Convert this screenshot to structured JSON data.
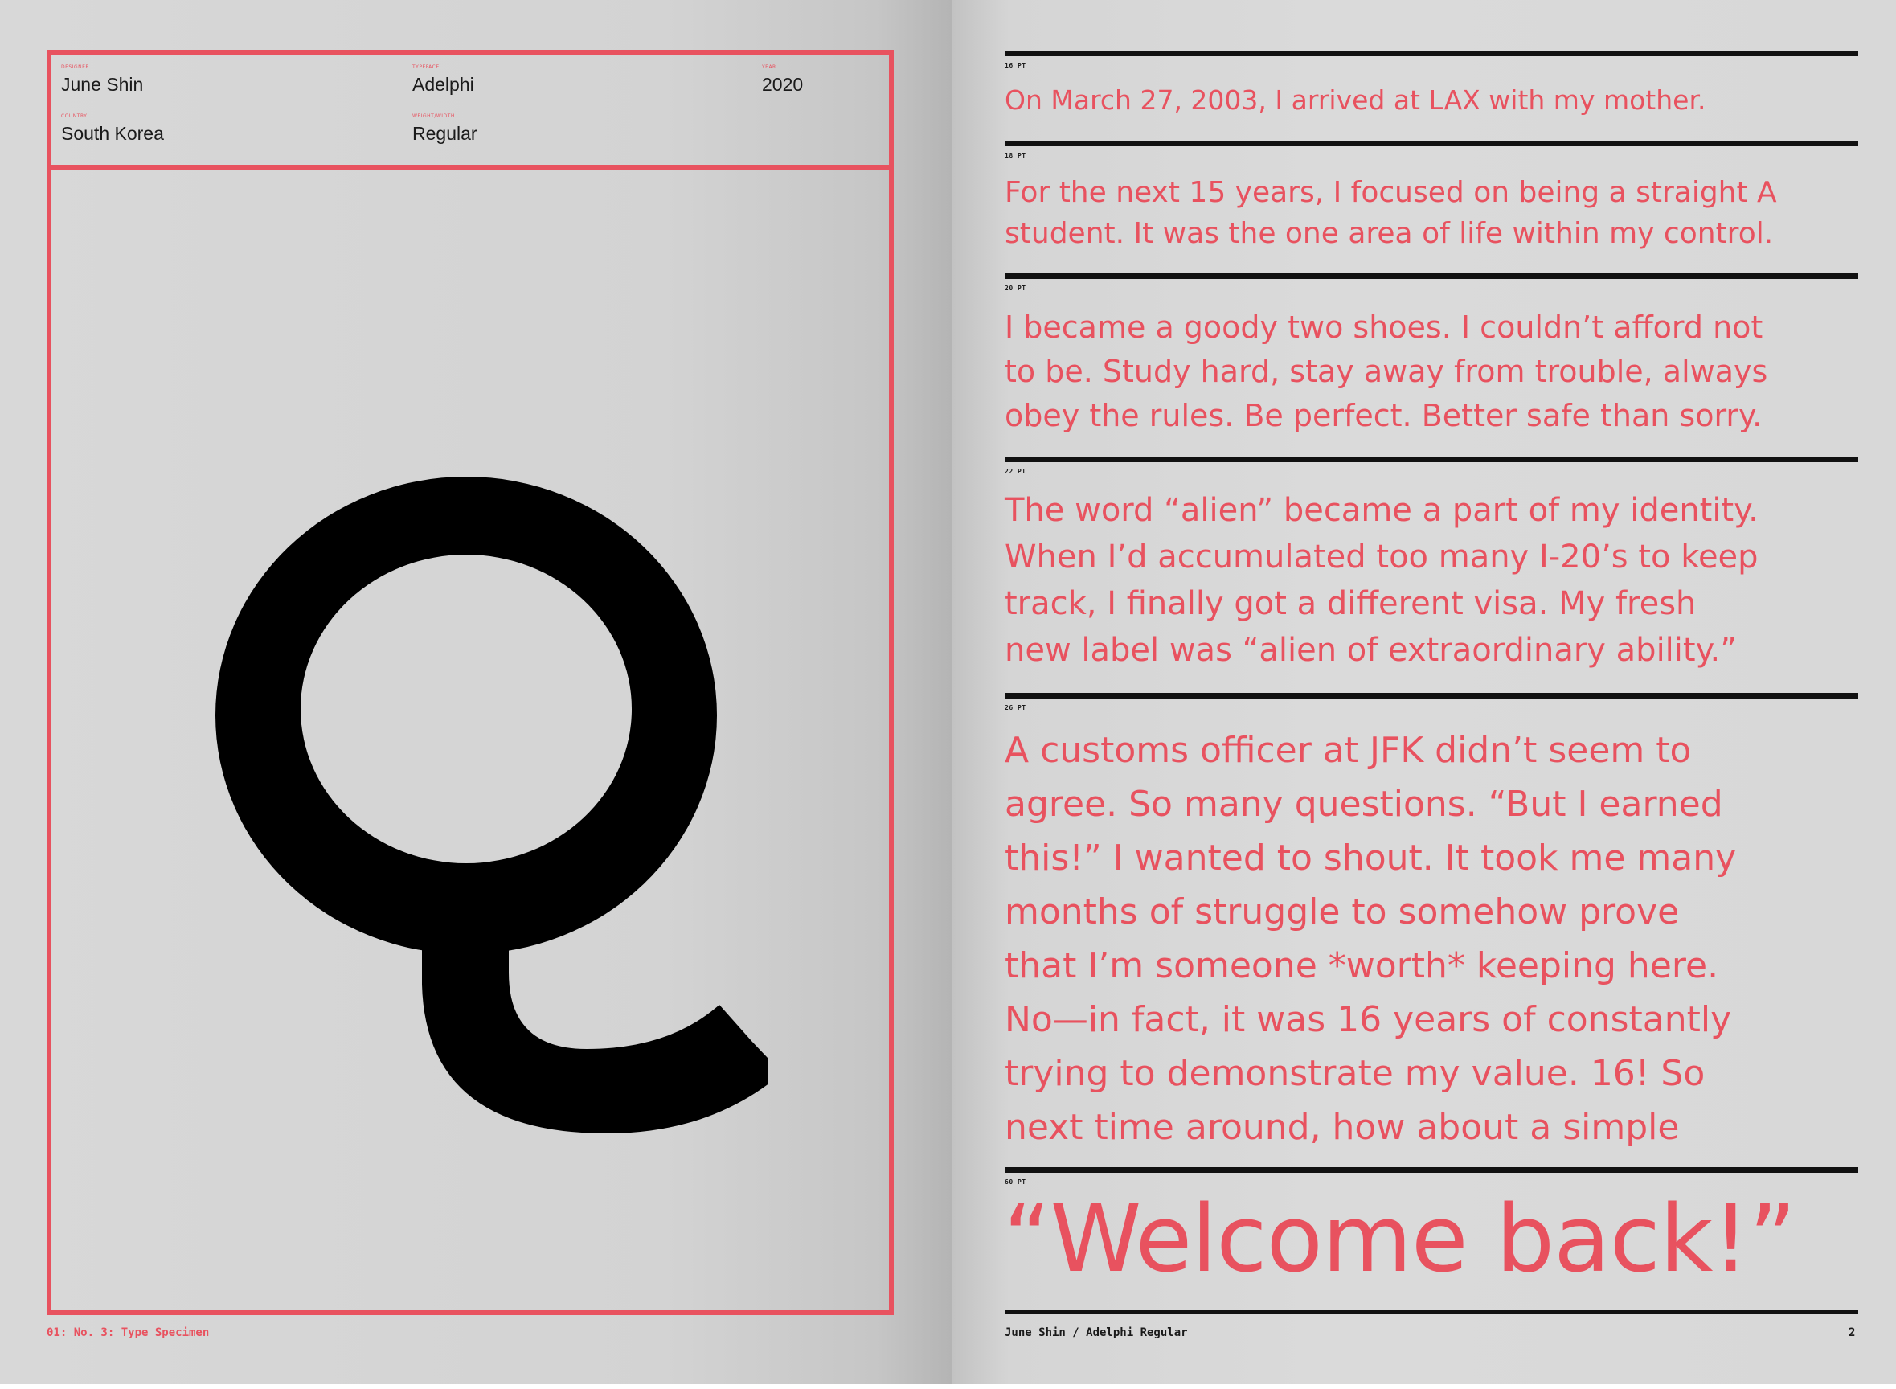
{
  "left_page": {
    "meta": {
      "designer": {
        "label": "Designer",
        "value": "June Shin"
      },
      "typeface": {
        "label": "Typeface",
        "value": "Adelphi"
      },
      "year": {
        "label": "Year",
        "value": "2020"
      },
      "country": {
        "label": "Country",
        "value": "South Korea"
      },
      "weight": {
        "label": "Weight/Width",
        "value": "Regular"
      }
    },
    "specimen_glyph": "Q",
    "footer": "01: No. 3: Type Specimen"
  },
  "right_page": {
    "paragraphs": [
      {
        "marker": "16 PT",
        "lines": [
          "On March 27, 2003, I arrived at LAX with my mother."
        ]
      },
      {
        "marker": "18 PT",
        "lines": [
          "For the next 15 years, I focused on being a straight A",
          "student. It was the one area of life within my control."
        ]
      },
      {
        "marker": "20 PT",
        "lines": [
          "I became a goody two shoes. I couldn’t afford not",
          "to be. Study hard, stay away from trouble, always",
          "obey the rules. Be perfect. Better safe than sorry."
        ]
      },
      {
        "marker": "22 PT",
        "lines": [
          "The word “alien” became a part of my identity.",
          "When I’d accumulated too many I-20’s to keep",
          "track, I finally got a different visa. My fresh",
          "new label was “alien of extraordinary ability.”"
        ]
      },
      {
        "marker": "26 PT",
        "lines": [
          "A customs officer at JFK didn’t seem to",
          "agree. So many questions. “But I earned",
          "this!” I wanted to shout. It took me many",
          "months of struggle to somehow prove",
          "that I’m someone *worth* keeping here.",
          "No—in fact, it was 16 years of constantly",
          "trying to demonstrate my value. 16! So",
          "next time around, how about a simple"
        ]
      }
    ],
    "closing_marker": "60 PT",
    "closing_line": "“Welcome back!”",
    "footer_credit": "June Shin / Adelphi Regular",
    "page_number": "2"
  },
  "colors": {
    "accent": "#e8525f",
    "ink": "#111111",
    "paper": "#d6d6d6"
  }
}
